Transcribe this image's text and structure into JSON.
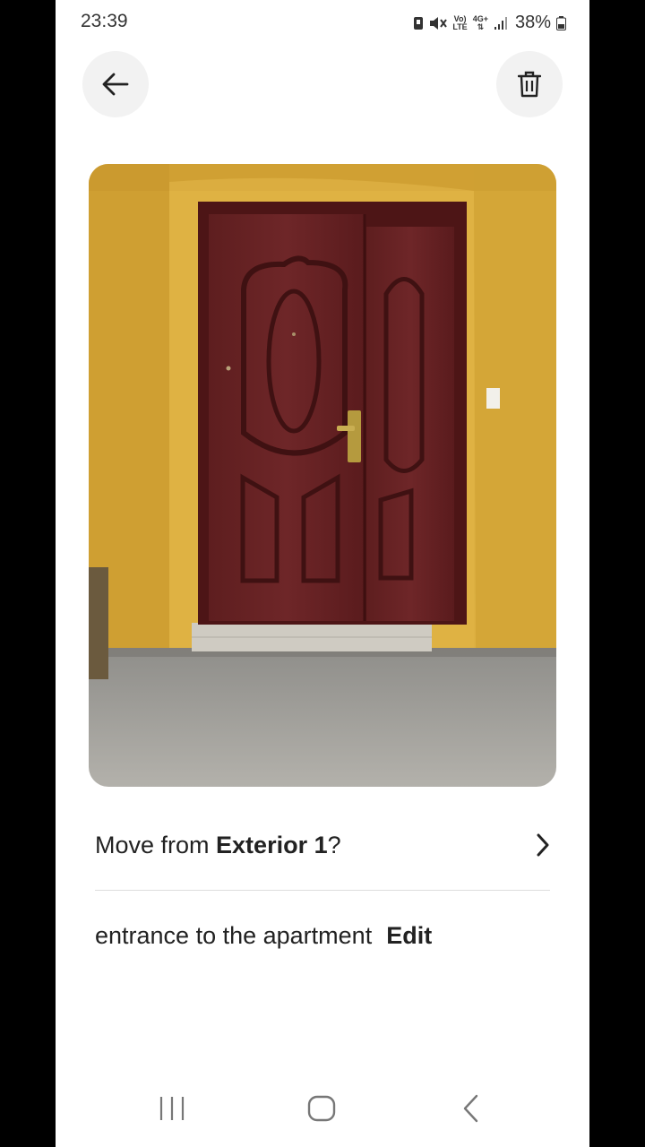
{
  "status_bar": {
    "time": "23:39",
    "network_top": "Vo)",
    "network_bottom": "LTE",
    "data_type": "4G+",
    "battery": "38%"
  },
  "header": {
    "back_icon": "arrow-left-icon",
    "delete_icon": "trash-icon"
  },
  "photo": {
    "subject": "door-photo"
  },
  "move": {
    "prefix": "Move from ",
    "location": "Exterior 1",
    "suffix": "?"
  },
  "caption": {
    "text": "entrance to the apartment",
    "edit_label": "Edit"
  },
  "nav": {
    "recents_icon": "recents-icon",
    "home_icon": "home-icon",
    "back_icon": "back-chevron-icon"
  }
}
